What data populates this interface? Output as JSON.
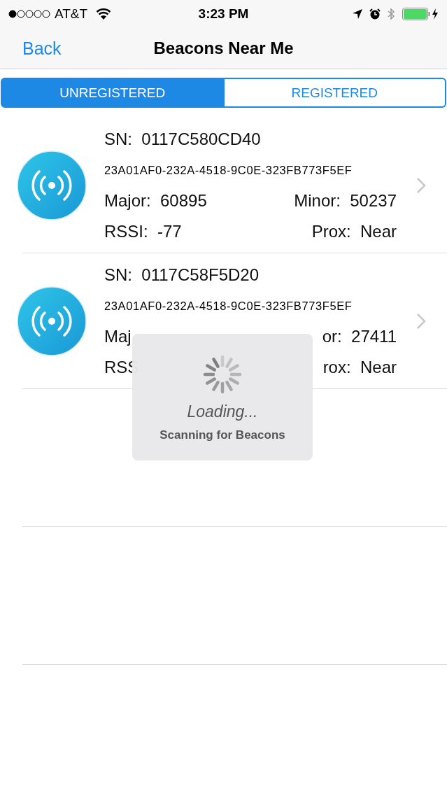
{
  "status_bar": {
    "carrier": "AT&T",
    "time": "3:23 PM"
  },
  "nav": {
    "back": "Back",
    "title": "Beacons Near Me"
  },
  "tabs": [
    {
      "label": "UNREGISTERED",
      "selected": true
    },
    {
      "label": "REGISTERED",
      "selected": false
    }
  ],
  "beacons": [
    {
      "sn": "SN:  0117C580CD40",
      "uuid": "23A01AF0-232A-4518-9C0E-323FB773F5EF",
      "major": "Major:  60895",
      "minor": "Minor:  50237",
      "rssi": "RSSI:  -77",
      "prox": "Prox:  Near"
    },
    {
      "sn": "SN:  0117C58F5D20",
      "uuid": "23A01AF0-232A-4518-9C0E-323FB773F5EF",
      "major": "Maj",
      "minor": "or:  27411",
      "rssi": "RSS",
      "prox": "rox:  Near"
    }
  ],
  "loading": {
    "title": "Loading...",
    "message": "Scanning for Beacons"
  }
}
